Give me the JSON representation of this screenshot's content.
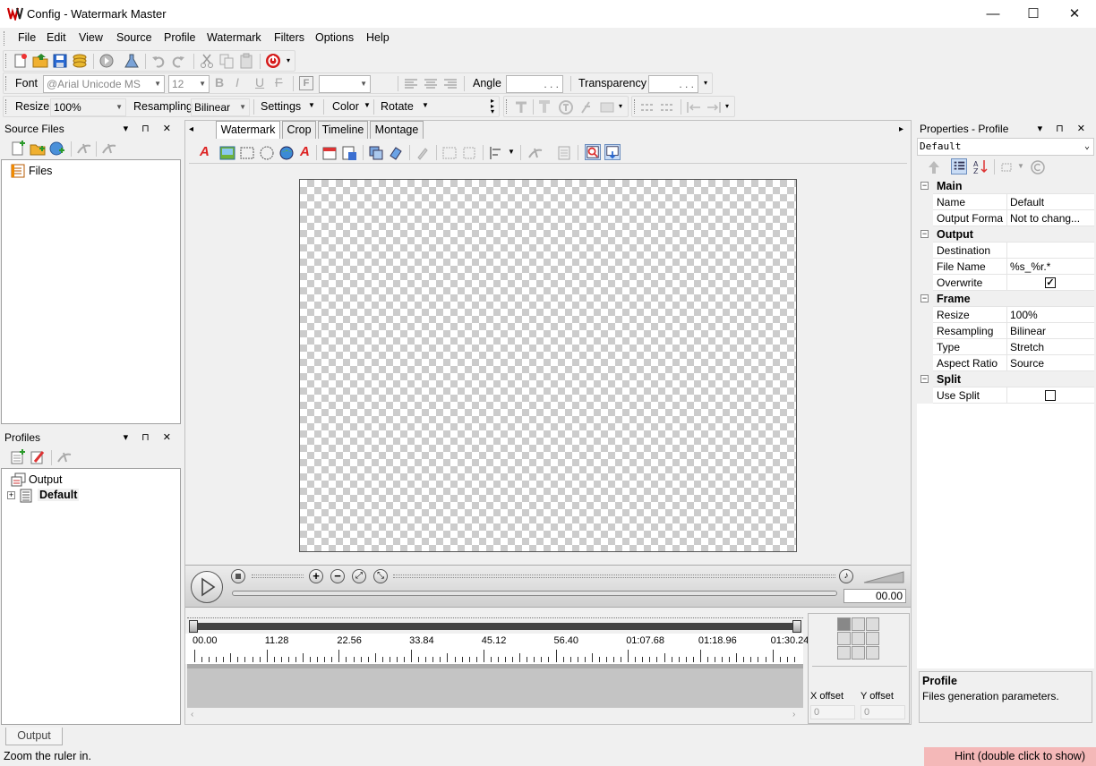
{
  "window": {
    "title": "Config - Watermark Master",
    "minimize": "—",
    "maximize": "☐",
    "close": "✕"
  },
  "menu": [
    "File",
    "Edit",
    "View",
    "Source",
    "Profile",
    "Watermark",
    "Filters",
    "Options",
    "Help"
  ],
  "font_toolbar": {
    "font_label": "Font",
    "font_value": "@Arial Unicode MS",
    "size_value": "12",
    "angle_label": "Angle",
    "transparency_label": "Transparency",
    "ellipsis": ". . ."
  },
  "frame_toolbar": {
    "resize_label": "Resize",
    "resize_value": "100%",
    "resampling_label": "Resampling",
    "resampling_value": "Bilinear",
    "settings_label": "Settings",
    "color_label": "Color",
    "rotate_label": "Rotate"
  },
  "source_files": {
    "title": "Source Files",
    "tree": [
      "Files"
    ]
  },
  "profiles": {
    "title": "Profiles",
    "tree": [
      "Output",
      "Default"
    ]
  },
  "tabs": [
    "Watermark",
    "Crop",
    "Timeline",
    "Montage"
  ],
  "player": {
    "time": "00.00"
  },
  "ruler": {
    "labels": [
      "00.00",
      "11.28",
      "22.56",
      "33.84",
      "45.12",
      "56.40",
      "01:07.68",
      "01:18.96",
      "01:30.24"
    ]
  },
  "offsets": {
    "x_label": "X offset",
    "y_label": "Y offset",
    "x_value": "0",
    "y_value": "0"
  },
  "properties": {
    "title": "Properties - Profile",
    "selector": "Default",
    "rows": [
      {
        "kind": "cat",
        "name": "Main"
      },
      {
        "kind": "prop",
        "name": "Name",
        "value": "Default"
      },
      {
        "kind": "prop",
        "name": "Output Forma",
        "value": "Not to chang..."
      },
      {
        "kind": "cat",
        "name": "Output"
      },
      {
        "kind": "prop",
        "name": "Destination",
        "value": ""
      },
      {
        "kind": "prop",
        "name": "File Name",
        "value": "%s_%r.*"
      },
      {
        "kind": "check",
        "name": "Overwrite",
        "checked": true
      },
      {
        "kind": "cat",
        "name": "Frame"
      },
      {
        "kind": "prop",
        "name": "Resize",
        "value": "100%"
      },
      {
        "kind": "prop",
        "name": "Resampling",
        "value": "Bilinear"
      },
      {
        "kind": "prop",
        "name": "Type",
        "value": "Stretch"
      },
      {
        "kind": "prop",
        "name": "Aspect Ratio",
        "value": "Source"
      },
      {
        "kind": "cat",
        "name": "Split"
      },
      {
        "kind": "check",
        "name": "Use Split",
        "checked": false
      }
    ],
    "help_title": "Profile",
    "help_text": "Files generation parameters."
  },
  "bottom_tab": "Output",
  "status": {
    "text": "Zoom the ruler in.",
    "hint": "Hint (double click to show)"
  },
  "colors": {
    "hint_bg": "#f4b8b8",
    "checker": "#cccccc"
  }
}
